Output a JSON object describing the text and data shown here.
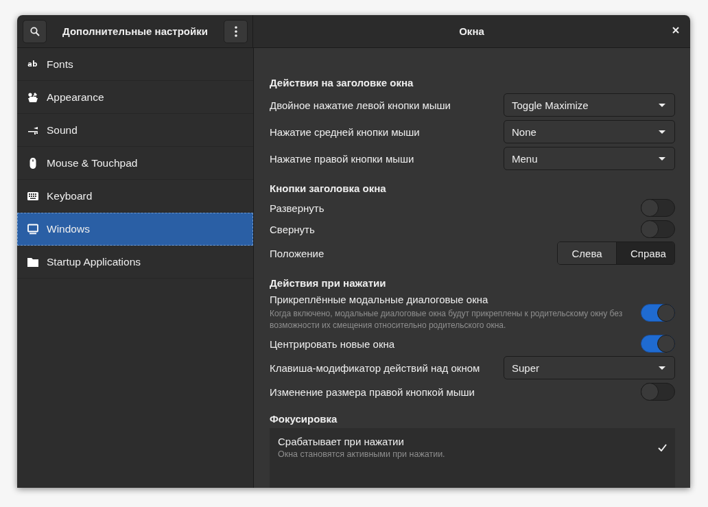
{
  "window": {
    "sidebar_title": "Дополнительные настройки",
    "title": "Окна"
  },
  "sidebar": {
    "items": [
      {
        "label": "Fonts",
        "selected": false
      },
      {
        "label": "Appearance",
        "selected": false
      },
      {
        "label": "Sound",
        "selected": false
      },
      {
        "label": "Mouse & Touchpad",
        "selected": false
      },
      {
        "label": "Keyboard",
        "selected": false
      },
      {
        "label": "Windows",
        "selected": true
      },
      {
        "label": "Startup Applications",
        "selected": false
      }
    ]
  },
  "sections": [
    {
      "title": "Действия на заголовке окна",
      "rows": [
        {
          "kind": "combo",
          "label": "Двойное нажатие левой кнопки мыши",
          "value": "Toggle Maximize"
        },
        {
          "kind": "combo",
          "label": "Нажатие средней кнопки мыши",
          "value": "None"
        },
        {
          "kind": "combo",
          "label": "Нажатие правой кнопки мыши",
          "value": "Menu"
        }
      ]
    },
    {
      "title": "Кнопки заголовка окна",
      "rows": [
        {
          "kind": "switch",
          "label": "Развернуть",
          "on": false
        },
        {
          "kind": "switch",
          "label": "Свернуть",
          "on": false
        },
        {
          "kind": "segmented",
          "label": "Положение",
          "options": [
            {
              "label": "Слева",
              "selected": false
            },
            {
              "label": "Справа",
              "selected": true
            }
          ]
        }
      ]
    },
    {
      "title": "Действия при нажатии",
      "rows": [
        {
          "kind": "switch",
          "label": "Прикреплённые модальные диалоговые окна",
          "description": "Когда включено, модальные диалоговые окна будут прикреплены к родительскому окну без возможности их смещения относительно родительского окна.",
          "on": true
        },
        {
          "kind": "switch",
          "label": "Центрировать новые окна",
          "on": true
        },
        {
          "kind": "combo",
          "label": "Клавиша-модификатор действий над окном",
          "value": "Super"
        },
        {
          "kind": "switch",
          "label": "Изменение размера правой кнопкой мыши",
          "on": false
        }
      ]
    },
    {
      "title": "Фокусировка",
      "rows": [
        {
          "kind": "choices",
          "items": [
            {
              "label": "Срабатывает при нажатии",
              "description": "Окна становятся активными при нажатии.",
              "selected": true
            }
          ]
        }
      ]
    }
  ]
}
